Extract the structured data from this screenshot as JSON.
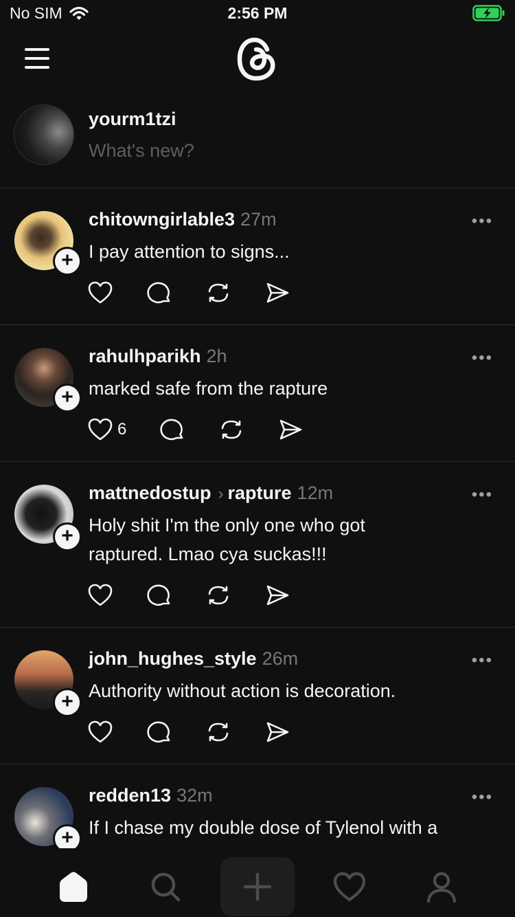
{
  "status_bar": {
    "carrier": "No SIM",
    "time": "2:56 PM"
  },
  "composer": {
    "username": "yourm1tzi",
    "placeholder": "What's new?"
  },
  "posts": [
    {
      "username": "chitowngirlable3",
      "time": "27m",
      "text": "I pay attention to signs...",
      "likes": ""
    },
    {
      "username": "rahulhparikh",
      "time": "2h",
      "text": "marked safe from the rapture",
      "likes": "6"
    },
    {
      "username": "mattnedostup",
      "topic": "rapture",
      "time": "12m",
      "text": "Holy shit I'm the only one who got raptured. Lmao cya suckas!!!",
      "likes": ""
    },
    {
      "username": "john_hughes_style",
      "time": "26m",
      "text": "Authority without action is decoration.",
      "likes": ""
    },
    {
      "username": "redden13",
      "time": "32m",
      "text": "If I chase my double dose of Tylenol with a",
      "likes": ""
    }
  ],
  "icons": {
    "menu": "hamburger-icon",
    "logo": "threads-logo",
    "like": "heart-icon",
    "reply": "comment-icon",
    "repost": "repost-icon",
    "share": "send-icon",
    "more": "more-icon",
    "follow": "plus-icon"
  },
  "tabs": [
    "home",
    "search",
    "new-thread",
    "activity",
    "profile"
  ],
  "colors": {
    "background": "#101010",
    "text": "#f3f5f7",
    "muted": "#777777",
    "divider": "#2d2d2d",
    "battery": "#30d158"
  }
}
